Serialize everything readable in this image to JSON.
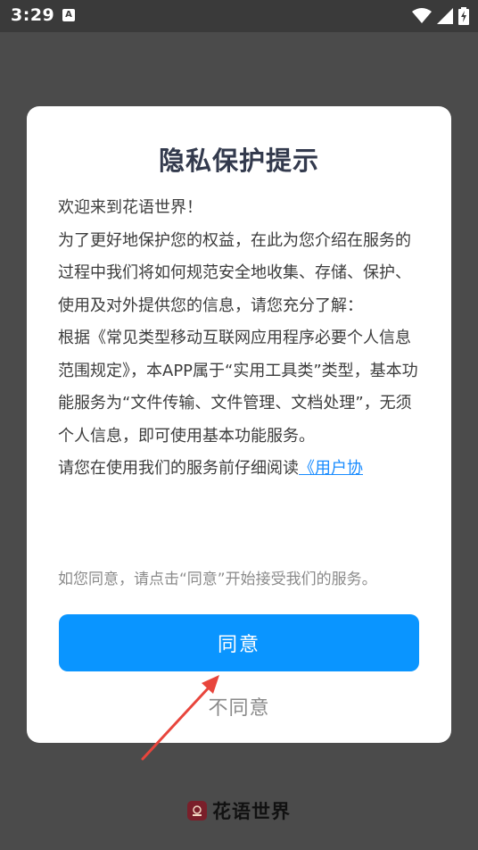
{
  "status_bar": {
    "time": "3:29",
    "notification_icon": "A"
  },
  "dialog": {
    "title": "隐私保护提示",
    "paragraphs": [
      "欢迎来到花语世界！",
      "为了更好地保护您的权益，在此为您介绍在服务的过程中我们将如何规范安全地收集、存储、保护、使用及对外提供您的信息，请您充分了解：",
      "根据《常见类型移动互联网应用程序必要个人信息范围规定》，本APP属于“实用工具类”类型，基本功能服务为“文件传输、文件管理、文档处理”，无须个人信息，即可使用基本功能服务。"
    ],
    "read_prompt": "请您在使用我们的服务前仔细阅读",
    "agreement_link": "《用户协",
    "consent_note": "如您同意，请点击“同意”开始接受我们的服务。",
    "agree_label": "同意",
    "disagree_label": "不同意"
  },
  "brand": {
    "name": "花语世界",
    "logo_color": "#7a1f2a"
  },
  "colors": {
    "accent": "#0a95ff",
    "link": "#1a8cff",
    "annotation_arrow": "#e8453c"
  }
}
